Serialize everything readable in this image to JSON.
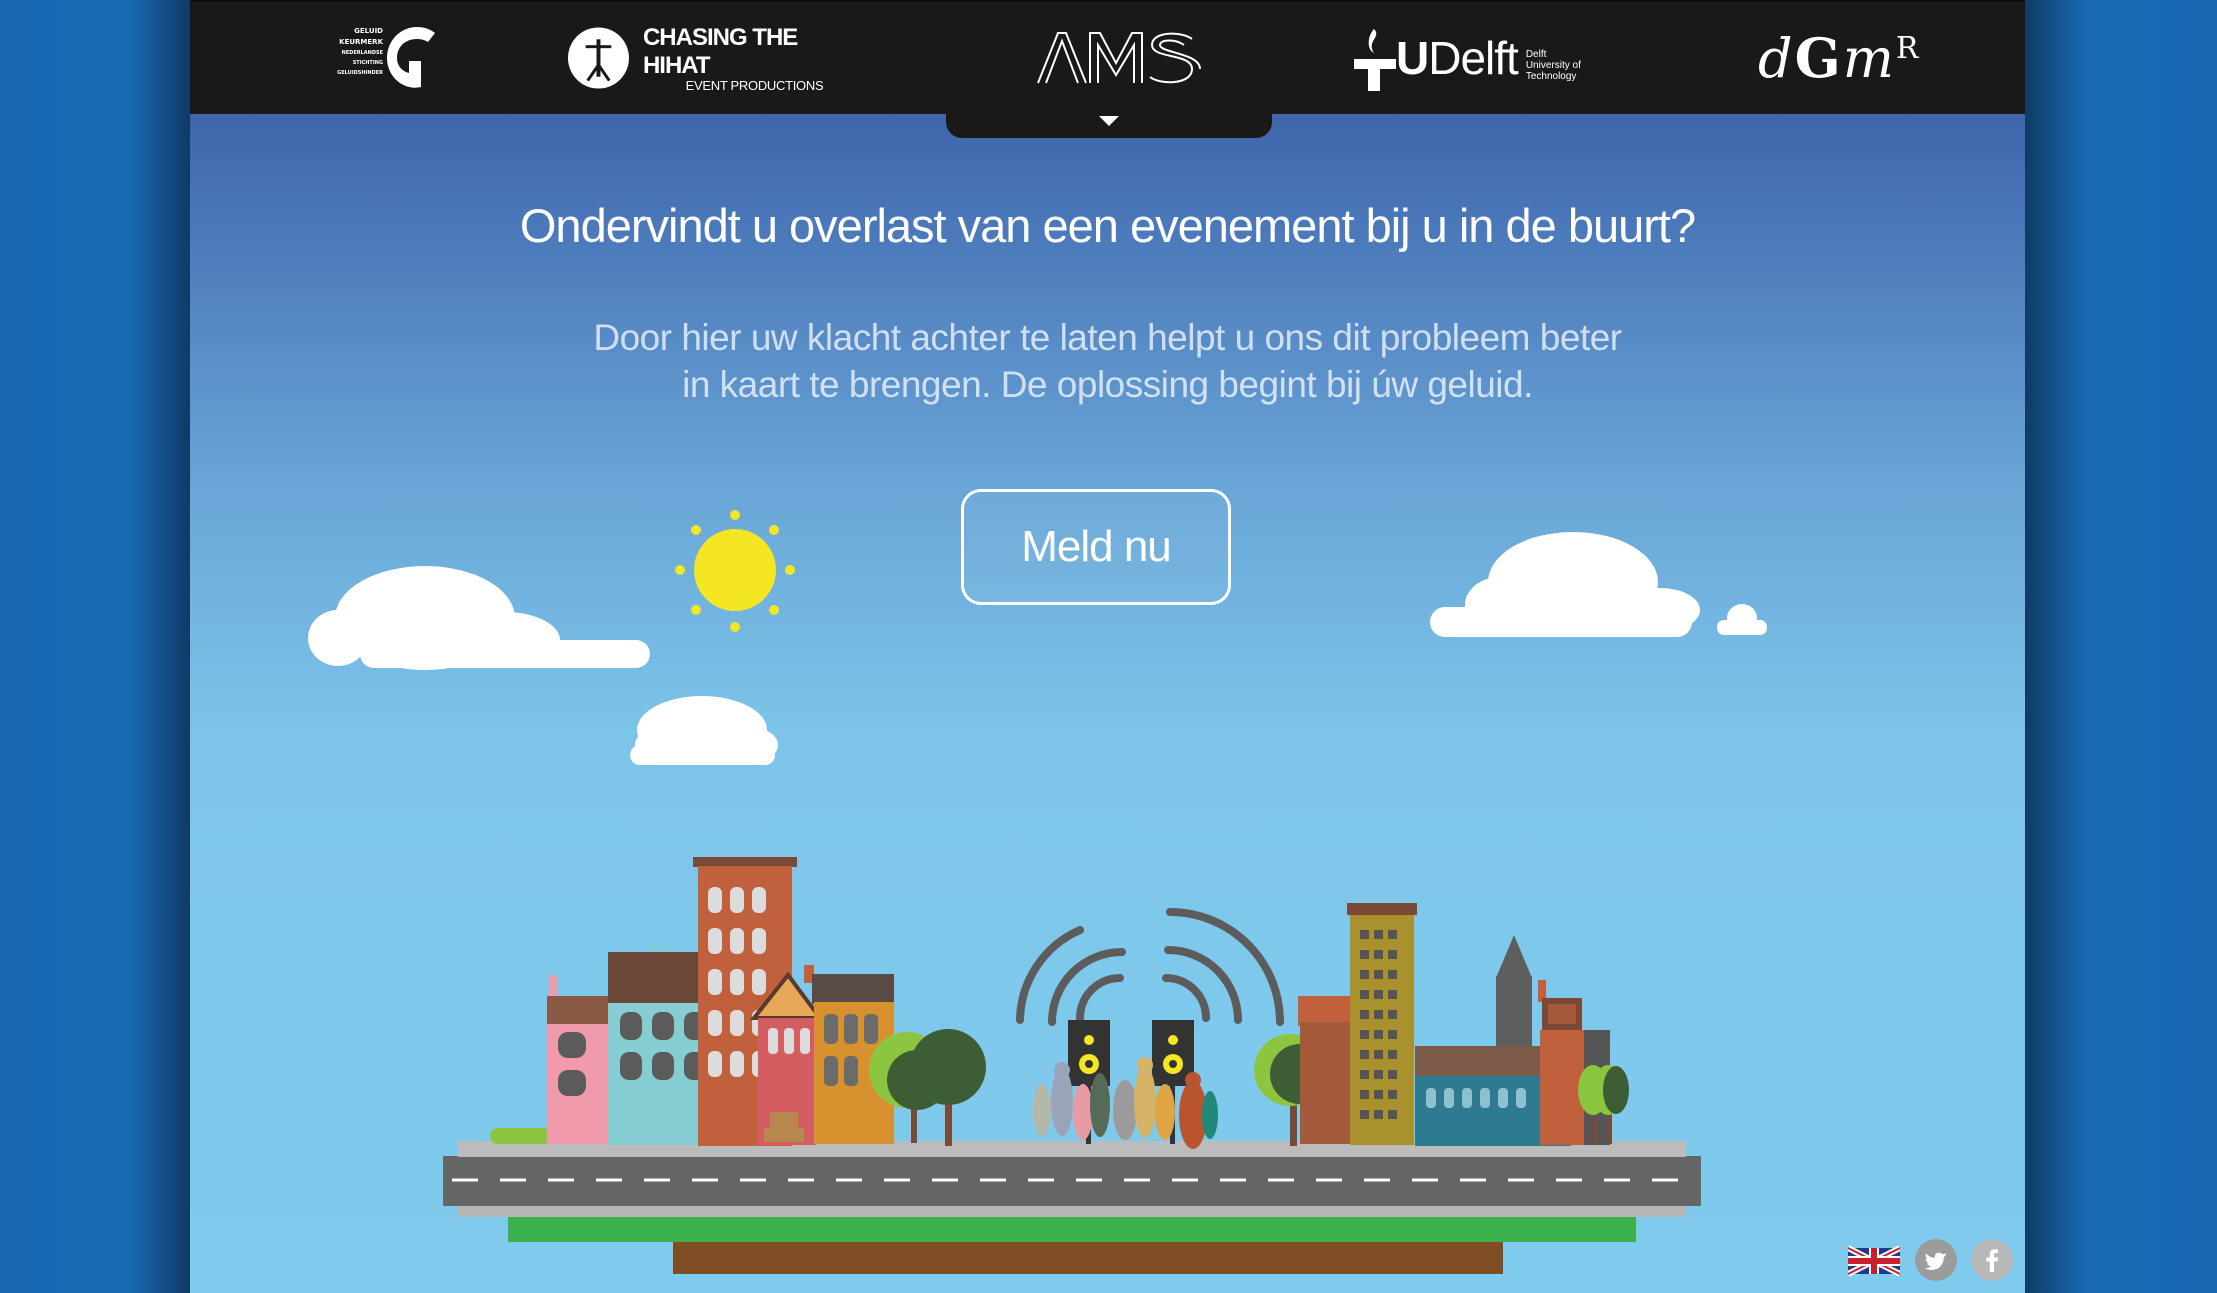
{
  "topbar": {
    "logos": {
      "geluidkeurmerk": {
        "name": "Stichting Geluidkeurmerk Nederlandse Geluidshinder",
        "lines": [
          "GELUID",
          "KEURMERK",
          "NEDERLANDSE",
          "STICHTING",
          "GELUIDSHINDER"
        ],
        "mark": "G"
      },
      "hihat": {
        "title": "CHASING THE HIHAT",
        "subtitle": "EVENT PRODUCTIONS"
      },
      "ams": {
        "text": "AMS"
      },
      "tudelft": {
        "wordmark": "TUDelft",
        "line1": "Delft",
        "line2": "University of",
        "line3": "Technology"
      },
      "dgmr": {
        "text": "dGmR"
      }
    },
    "dropdown_icon": "caret-down-icon"
  },
  "hero": {
    "headline": "Ondervindt u overlast van een evenement bij u in de buurt?",
    "sub_line1": "Door hier uw klacht achter te laten helpt u ons dit probleem beter",
    "sub_line2": "in kaart te brengen. De oplossing begint bij úw geluid.",
    "cta_label": "Meld nu"
  },
  "footer": {
    "language_icon": "uk-flag-icon",
    "twitter_icon": "twitter-icon",
    "facebook_icon": "facebook-icon"
  },
  "colors": {
    "topbar": "#1b1918",
    "sky_top": "#33539d",
    "sky_bottom": "#7fcbed",
    "sun": "#f5e624",
    "road": "#666666",
    "grass": "#3cb04a",
    "soil": "#7e4d24"
  }
}
